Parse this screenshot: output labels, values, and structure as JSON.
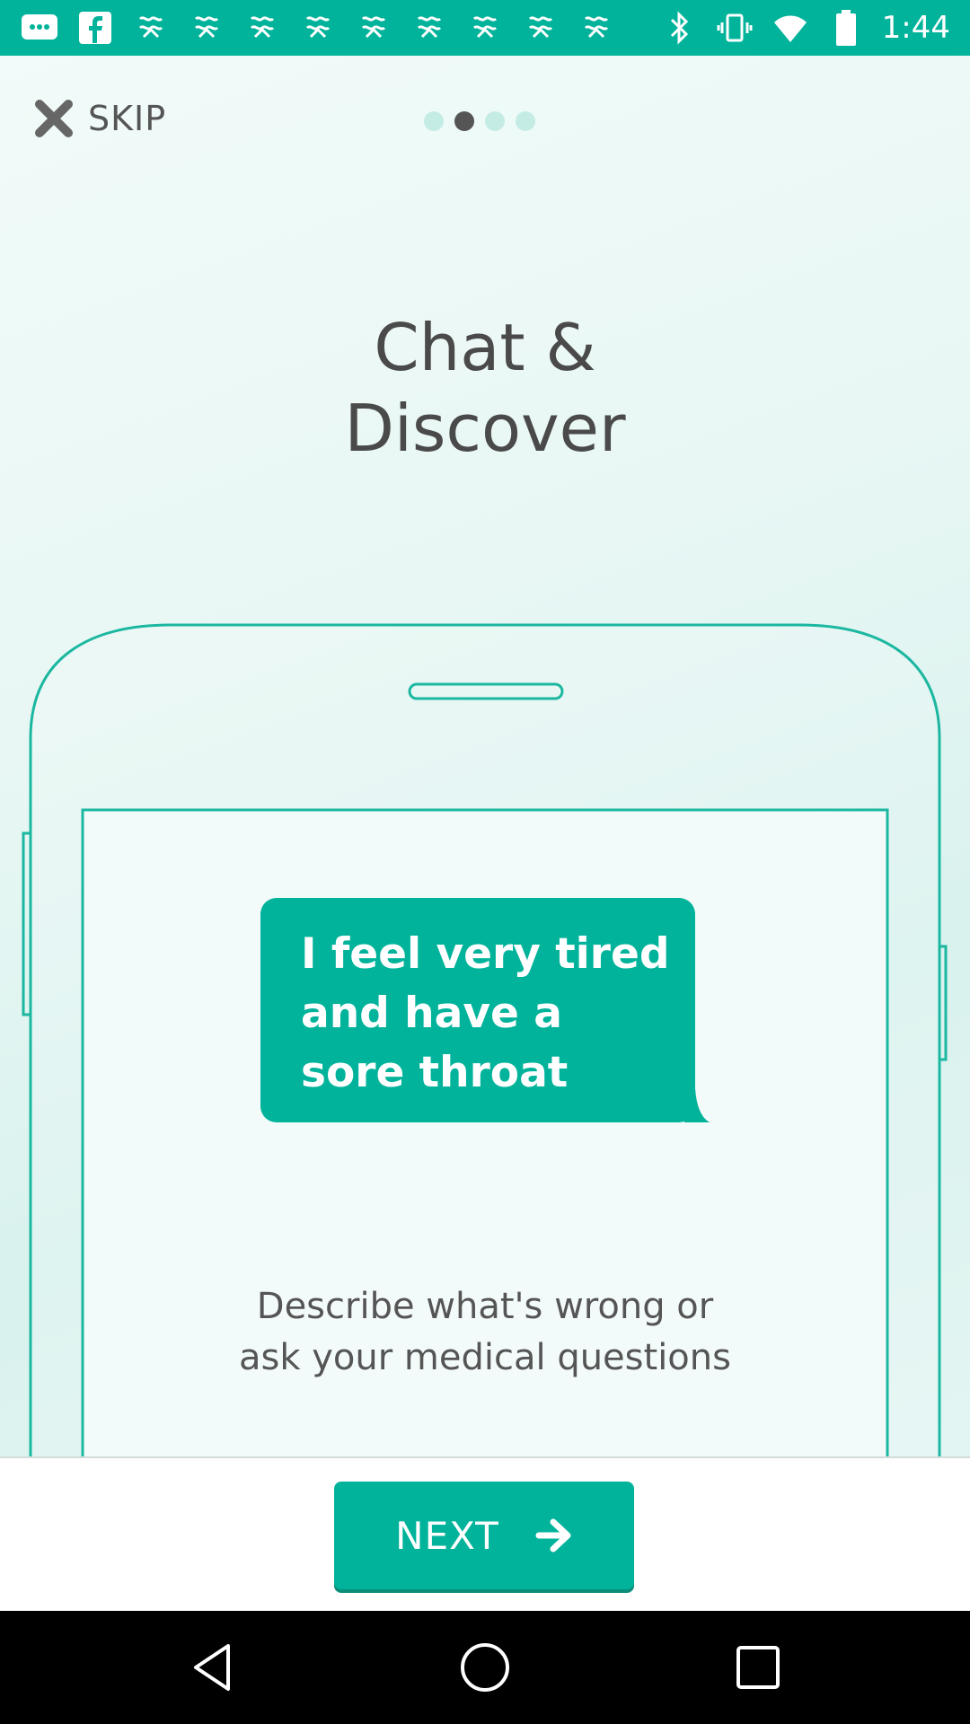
{
  "status_bar": {
    "time": "1:44",
    "left_icons": [
      "messages-icon",
      "facebook-icon",
      "notification-icon",
      "notification-icon",
      "notification-icon",
      "notification-icon",
      "notification-icon",
      "notification-icon",
      "notification-icon",
      "notification-icon",
      "notification-icon"
    ],
    "right_icons": [
      "bluetooth-icon",
      "vibrate-icon",
      "wifi-icon",
      "battery-icon"
    ],
    "background": "#00b39a"
  },
  "onboarding": {
    "skip_label": "SKIP",
    "page_indicator": {
      "total": 4,
      "current": 2
    },
    "title_line1": "Chat &",
    "title_line2": "Discover",
    "chat_bubble": "I feel very tired and have a sore throat",
    "description_line1": "Describe what's wrong or",
    "description_line2": "ask your medical questions"
  },
  "footer": {
    "next_label": "NEXT"
  },
  "colors": {
    "accent": "#00b39a",
    "text": "#4a4a4a"
  }
}
